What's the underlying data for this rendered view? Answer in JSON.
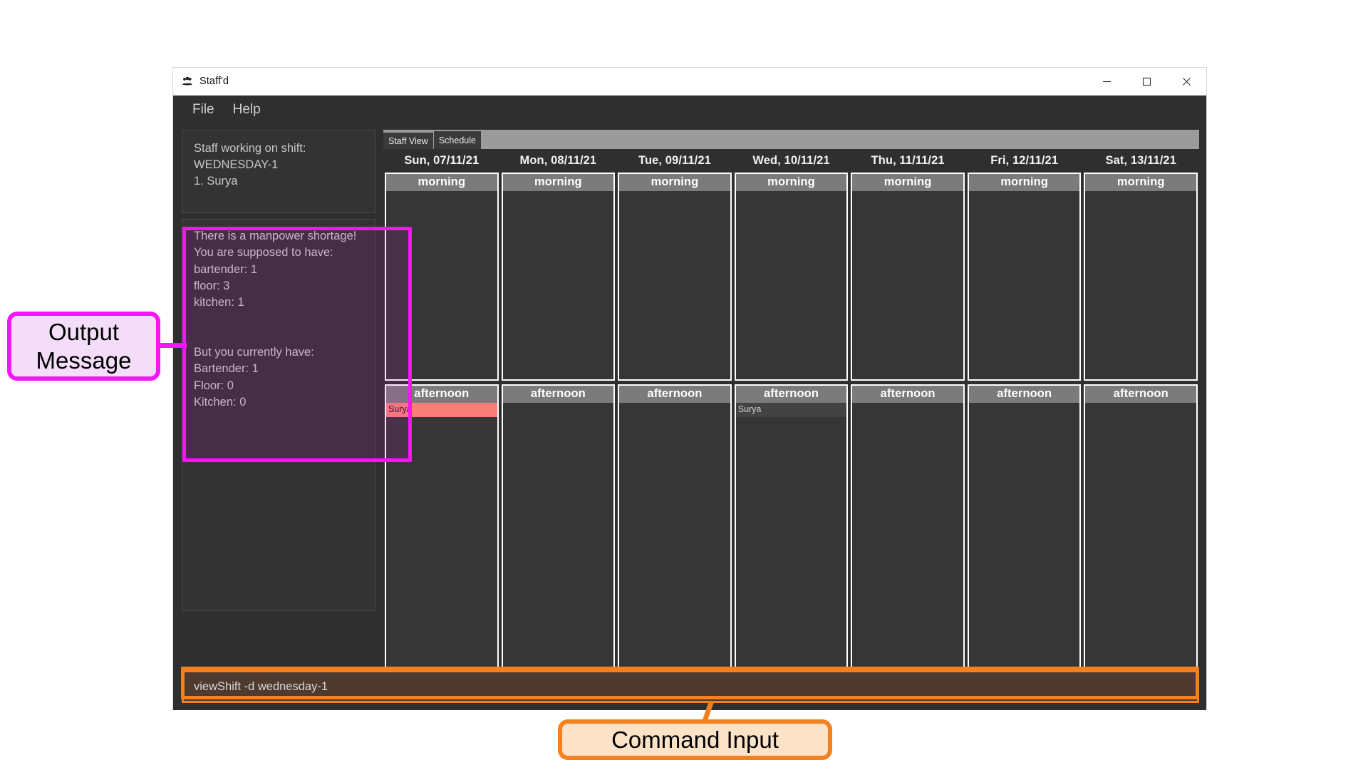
{
  "window": {
    "title": "Staff'd",
    "icon": "app-icon",
    "controls": {
      "minimize": "─",
      "maximize": "☐",
      "close": "✕"
    }
  },
  "menu": {
    "items": [
      {
        "label": "File"
      },
      {
        "label": "Help"
      }
    ]
  },
  "left_pane": {
    "staff_box": {
      "lines": [
        "Staff working on shift:",
        "WEDNESDAY-1",
        "1. Surya"
      ]
    },
    "output_box": {
      "lines": [
        "There is a manpower shortage!",
        "You are supposed to have:",
        "bartender: 1",
        "floor: 3",
        "kitchen: 1",
        "",
        "",
        "But you currently have:",
        "Bartender: 1",
        "Floor: 0",
        "Kitchen: 0"
      ]
    }
  },
  "tabs": [
    {
      "label": "Staff View",
      "active": false
    },
    {
      "label": "Schedule",
      "active": true
    }
  ],
  "schedule": {
    "days": [
      {
        "header": "Sun, 07/11/21",
        "shifts": [
          {
            "title": "morning",
            "staff": []
          },
          {
            "title": "afternoon",
            "staff": [
              {
                "name": "Surya",
                "highlight": true
              }
            ]
          }
        ]
      },
      {
        "header": "Mon, 08/11/21",
        "shifts": [
          {
            "title": "morning",
            "staff": []
          },
          {
            "title": "afternoon",
            "staff": []
          }
        ]
      },
      {
        "header": "Tue, 09/11/21",
        "shifts": [
          {
            "title": "morning",
            "staff": []
          },
          {
            "title": "afternoon",
            "staff": []
          }
        ]
      },
      {
        "header": "Wed, 10/11/21",
        "shifts": [
          {
            "title": "morning",
            "staff": []
          },
          {
            "title": "afternoon",
            "staff": [
              {
                "name": "Surya",
                "highlight": false
              }
            ]
          }
        ]
      },
      {
        "header": "Thu, 11/11/21",
        "shifts": [
          {
            "title": "morning",
            "staff": []
          },
          {
            "title": "afternoon",
            "staff": []
          }
        ]
      },
      {
        "header": "Fri, 12/11/21",
        "shifts": [
          {
            "title": "morning",
            "staff": []
          },
          {
            "title": "afternoon",
            "staff": []
          }
        ]
      },
      {
        "header": "Sat, 13/11/21",
        "shifts": [
          {
            "title": "morning",
            "staff": []
          },
          {
            "title": "afternoon",
            "staff": []
          }
        ]
      }
    ]
  },
  "command": {
    "value": "viewShift -d wednesday-1",
    "placeholder": ""
  },
  "annotations": [
    {
      "id": "output-message",
      "label": "Output Message",
      "accent": "#f714f7"
    },
    {
      "id": "command-input",
      "label": "Command Input",
      "accent": "#f4811f"
    }
  ],
  "colors": {
    "window_bg": "#2f2f2f",
    "panel_bg": "#333333",
    "shift_header": "#7b7b7b",
    "shift_body": "#363636",
    "staff_highlight": "#fa7e77",
    "cmd_bg": "#4e3a2e",
    "accent_orange": "#f4811f",
    "accent_magenta": "#f714f7"
  }
}
